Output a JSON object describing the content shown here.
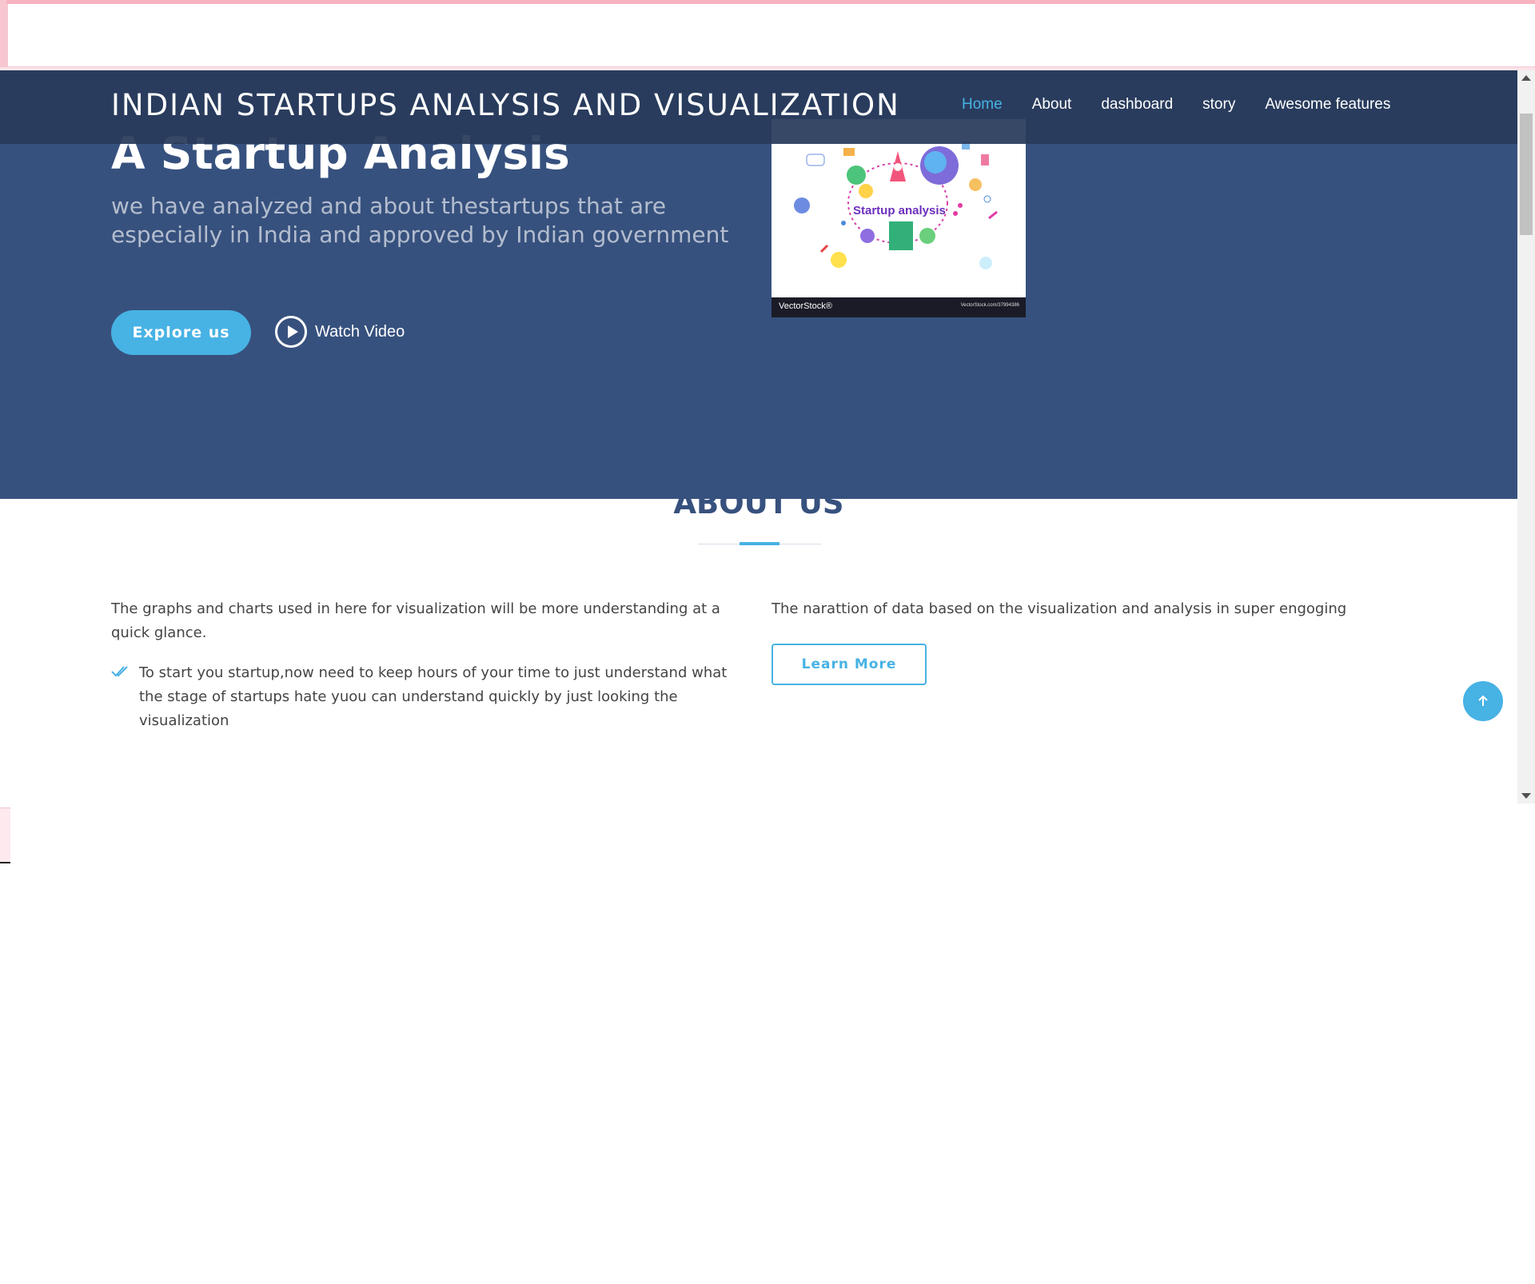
{
  "site": {
    "logo": "INDIAN STARTUPS ANALYSIS AND VISUALIZATION"
  },
  "nav": {
    "items": [
      "Home",
      "About",
      "dashboard",
      "story",
      "Awesome features"
    ],
    "active": "Home"
  },
  "hero": {
    "title": "A Startup Analysis",
    "subtitle": "we have analyzed and about thestartups that are especially in India and approved by Indian government",
    "explore_label": "Explore us",
    "watch_label": "Watch Video",
    "image": {
      "caption": "Startup analysis",
      "watermark_left": "VectorStock®",
      "watermark_right": "VectorStock.com/37994386"
    }
  },
  "about": {
    "title": "ABOUT US",
    "col1_text": "The graphs and charts used in here for visualization will be more understanding at a quick glance.",
    "col1_items": [
      "To start you startup,now need to keep hours of your time to just understand what the stage of startups hate yuou can understand quickly by just looking the visualization"
    ],
    "col2_text": "The narattion of data based on the visualization and analysis in super engoging",
    "learn_more_label": "Learn More"
  },
  "colors": {
    "hero_bg": "#37517e",
    "accent": "#47b2e4",
    "navbar_bg": "#283a5a",
    "heading": "#37517e"
  },
  "icons": {
    "play": "play-circle-icon",
    "check": "double-check-icon",
    "back_to_top": "arrow-up-icon"
  }
}
